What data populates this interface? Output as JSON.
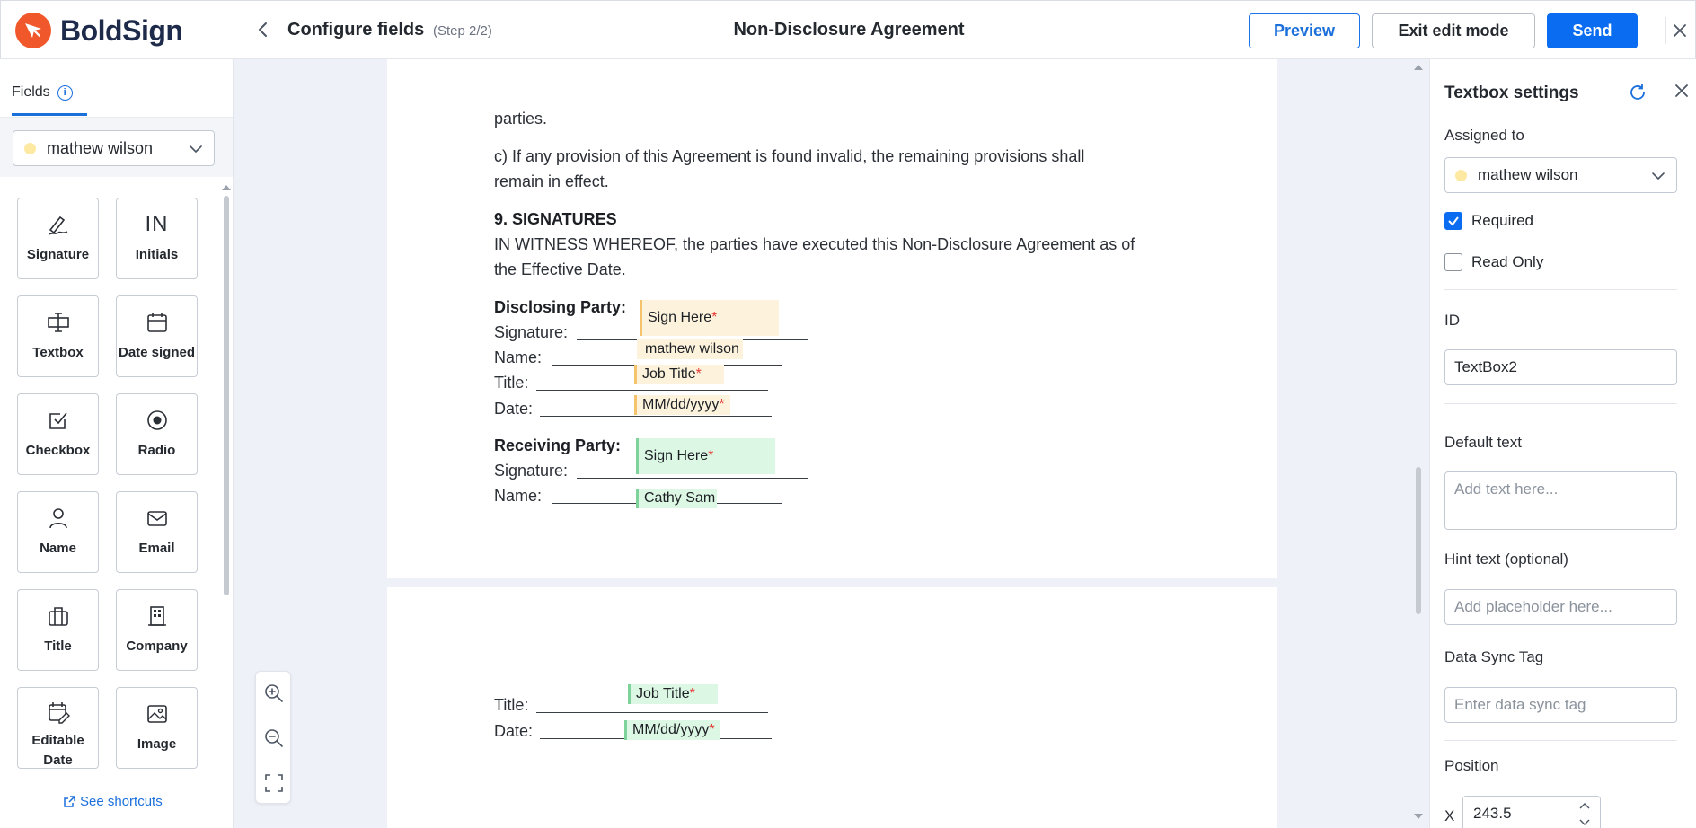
{
  "brand": {
    "name": "BoldSign",
    "accent": "#f0582b"
  },
  "header": {
    "title": "Configure fields",
    "step": "(Step 2/2)",
    "document_title": "Non-Disclosure Agreement",
    "preview_label": "Preview",
    "exit_label": "Exit edit mode",
    "send_label": "Send"
  },
  "sidebar": {
    "tab_label": "Fields",
    "assignee": "mathew wilson",
    "fields": [
      {
        "label": "Signature",
        "icon": "signature-icon"
      },
      {
        "label": "Initials",
        "icon": "initials-icon"
      },
      {
        "label": "Textbox",
        "icon": "textbox-icon"
      },
      {
        "label": "Date signed",
        "icon": "calendar-icon"
      },
      {
        "label": "Checkbox",
        "icon": "checkbox-icon"
      },
      {
        "label": "Radio",
        "icon": "radio-icon"
      },
      {
        "label": "Name",
        "icon": "user-icon"
      },
      {
        "label": "Email",
        "icon": "mail-icon"
      },
      {
        "label": "Title",
        "icon": "briefcase-icon"
      },
      {
        "label": "Company",
        "icon": "building-icon"
      },
      {
        "label": "Editable Date",
        "icon": "calendar-edit-icon"
      },
      {
        "label": "Image",
        "icon": "image-icon"
      }
    ],
    "initials_glyph": "IN",
    "shortcuts_label": "See shortcuts"
  },
  "document": {
    "line_parties": "parties.",
    "clause_c_1": "c) If any provision of this Agreement is found invalid, the remaining provisions shall",
    "clause_c_2": "remain in effect.",
    "section_heading": "9. SIGNATURES",
    "witness_1": "IN WITNESS WHEREOF, the parties have executed this Non-Disclosure Agreement as of",
    "witness_2": "the Effective Date.",
    "disclosing_label": "Disclosing Party:",
    "receiving_label": "Receiving Party:",
    "signature_label": "Signature:",
    "name_label": "Name:",
    "title_label": "Title:",
    "date_label": "Date:",
    "placed_fields": {
      "d_sign": "Sign Here",
      "d_name": "mathew wilson",
      "d_title": "Job Title",
      "d_date": "MM/dd/yyyy",
      "r_sign": "Sign Here",
      "r_name": "Cathy Sam",
      "r_title": "Job Title",
      "r_date": "MM/dd/yyyy",
      "required_mark": "*"
    }
  },
  "panel": {
    "title": "Textbox settings",
    "assigned_label": "Assigned to",
    "assigned_value": "mathew wilson",
    "required_label": "Required",
    "required_checked": true,
    "readonly_label": "Read Only",
    "readonly_checked": false,
    "id_label": "ID",
    "id_value": "TextBox2",
    "default_label": "Default text",
    "default_placeholder": "Add text here...",
    "hint_label": "Hint text (optional)",
    "hint_placeholder": "Add placeholder here...",
    "sync_label": "Data Sync Tag",
    "sync_placeholder": "Enter data sync tag",
    "position_label": "Position",
    "x_label": "X",
    "x_value": "243.5"
  }
}
